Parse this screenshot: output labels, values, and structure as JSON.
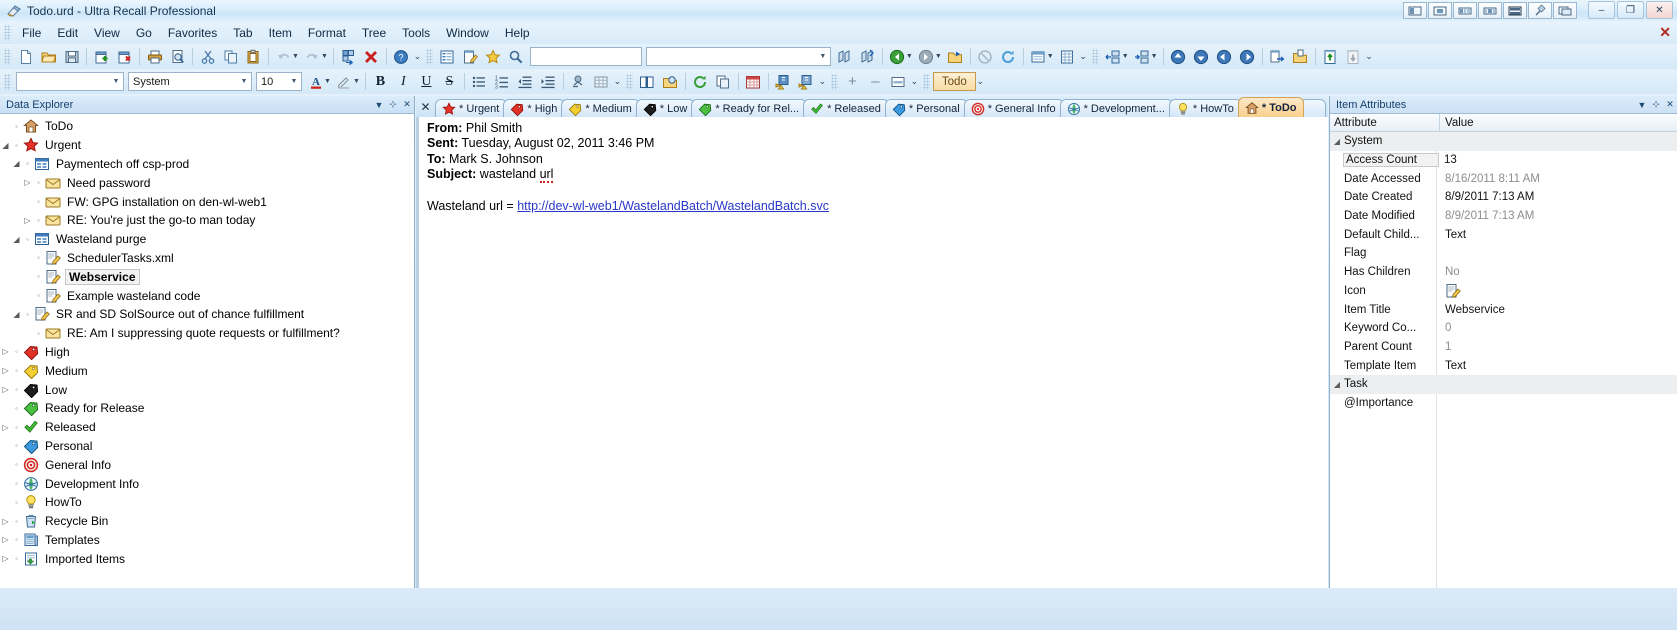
{
  "window": {
    "title": "Todo.urd - Ultra Recall Professional",
    "app_icon": "urd-app-icon",
    "layout_buttons": [
      "layout-1-icon",
      "layout-2-icon",
      "layout-3-icon",
      "layout-4-icon",
      "layout-5-icon",
      "pin-icon",
      "layout-6-icon"
    ],
    "minimize": "–",
    "maximize": "❐",
    "close": "✕"
  },
  "menu": {
    "items": [
      {
        "label": "File"
      },
      {
        "label": "Edit"
      },
      {
        "label": "View"
      },
      {
        "label": "Go"
      },
      {
        "label": "Favorites"
      },
      {
        "label": "Tab"
      },
      {
        "label": "Item"
      },
      {
        "label": "Format"
      },
      {
        "label": "Tree"
      },
      {
        "label": "Tools"
      },
      {
        "label": "Window"
      },
      {
        "label": "Help"
      }
    ],
    "close_doc_label": "✕"
  },
  "toolbar_main": {
    "buttons": [
      {
        "name": "new-document-icon"
      },
      {
        "name": "open-folder-icon"
      },
      {
        "name": "save-icon"
      },
      {
        "name": "new-item-icon"
      },
      {
        "name": "delete-item-icon"
      },
      {
        "name": "print-icon"
      },
      {
        "name": "print-preview-icon"
      },
      {
        "name": "cut-icon"
      },
      {
        "name": "copy-icon"
      },
      {
        "name": "paste-icon"
      },
      {
        "name": "undo-icon"
      },
      {
        "name": "redo-icon"
      },
      {
        "name": "insert-child-icon"
      },
      {
        "name": "delete-red-x-icon"
      },
      {
        "name": "help-icon"
      }
    ],
    "group2": [
      {
        "name": "outline-icon"
      },
      {
        "name": "edit-note-icon"
      },
      {
        "name": "favorites-star-icon"
      },
      {
        "name": "search-magnifier-icon"
      }
    ],
    "search_value": "",
    "search_placeholder": "",
    "group3": [
      {
        "name": "find-icon"
      },
      {
        "name": "find-next-icon"
      },
      {
        "name": "back-green-icon"
      },
      {
        "name": "forward-gray-icon"
      },
      {
        "name": "open-item-icon"
      },
      {
        "name": "cancel-icon"
      },
      {
        "name": "refresh-icon"
      },
      {
        "name": "pane-layout-icon"
      },
      {
        "name": "grid-icon"
      }
    ],
    "group4": [
      {
        "name": "indent-item-icon"
      },
      {
        "name": "outdent-item-icon"
      },
      {
        "name": "move-up-icon"
      },
      {
        "name": "move-down-icon"
      },
      {
        "name": "move-left-icon"
      },
      {
        "name": "move-right-icon"
      },
      {
        "name": "export-icon"
      },
      {
        "name": "import-icon"
      },
      {
        "name": "promote-icon"
      },
      {
        "name": "demote-icon"
      }
    ]
  },
  "toolbar_format": {
    "style_value": "",
    "font_value": "System",
    "size_value": "10",
    "buttons": [
      {
        "name": "font-color-icon"
      },
      {
        "name": "highlight-icon"
      },
      {
        "name": "bold-icon",
        "label": "B"
      },
      {
        "name": "italic-icon",
        "label": "I"
      },
      {
        "name": "underline-icon",
        "label": "U"
      },
      {
        "name": "strikethrough-icon",
        "label": "S"
      },
      {
        "name": "bullet-list-icon"
      },
      {
        "name": "numbered-list-icon"
      },
      {
        "name": "decrease-indent-icon"
      },
      {
        "name": "increase-indent-icon"
      },
      {
        "name": "insert-link-icon"
      },
      {
        "name": "insert-table-icon"
      }
    ],
    "group2": [
      {
        "name": "dictionary-icon"
      },
      {
        "name": "folder-search-icon"
      },
      {
        "name": "sync-icon"
      },
      {
        "name": "duplicate-icon"
      },
      {
        "name": "calendar-icon"
      },
      {
        "name": "reminder-add-icon"
      },
      {
        "name": "reminder-edit-icon"
      }
    ],
    "group3": [
      {
        "name": "expand-all-icon",
        "label": "+"
      },
      {
        "name": "collapse-all-icon",
        "label": "–"
      },
      {
        "name": "collapse-level-icon"
      }
    ],
    "tab_badge": "Todo"
  },
  "left_panel": {
    "title": "Data Explorer",
    "menu_icon": "chevron-down-icon",
    "pin_icon": "pin-icon",
    "close_icon": "close-icon",
    "tree": [
      {
        "label": "ToDo",
        "indent": 0,
        "icon": "home-icon",
        "expander": "",
        "selected": false
      },
      {
        "label": "Urgent",
        "indent": 0,
        "icon": "star-red-icon",
        "expander": "expanded",
        "selected": false
      },
      {
        "label": "Paymentech off csp-prod",
        "indent": 1,
        "icon": "calendar-blue-icon",
        "expander": "expanded",
        "selected": false
      },
      {
        "label": "Need password",
        "indent": 2,
        "icon": "envelope-icon",
        "expander": "collapsed",
        "selected": false
      },
      {
        "label": "FW: GPG installation on den-wl-web1",
        "indent": 2,
        "icon": "envelope-icon",
        "expander": "",
        "selected": false
      },
      {
        "label": "RE: You're just the go-to man today",
        "indent": 2,
        "icon": "envelope-icon",
        "expander": "collapsed",
        "selected": false
      },
      {
        "label": "Wasteland purge",
        "indent": 1,
        "icon": "calendar-blue-icon",
        "expander": "expanded",
        "selected": false
      },
      {
        "label": "SchedulerTasks.xml",
        "indent": 2,
        "icon": "note-edit-icon",
        "expander": "",
        "selected": false
      },
      {
        "label": "Webservice",
        "indent": 2,
        "icon": "note-edit-icon",
        "expander": "",
        "selected": true
      },
      {
        "label": "Example wasteland code",
        "indent": 2,
        "icon": "note-edit-icon",
        "expander": "",
        "selected": false
      },
      {
        "label": "SR and SD SolSource out of chance fulfillment",
        "indent": 1,
        "icon": "note-edit-icon",
        "expander": "expanded",
        "selected": false
      },
      {
        "label": "RE: Am I suppressing quote requests or fulfillment?",
        "indent": 2,
        "icon": "envelope-icon",
        "expander": "",
        "selected": false
      },
      {
        "label": "High",
        "indent": 0,
        "icon": "tag-red-icon",
        "expander": "collapsed",
        "selected": false
      },
      {
        "label": "Medium",
        "indent": 0,
        "icon": "tag-yellow-icon",
        "expander": "collapsed",
        "selected": false
      },
      {
        "label": "Low",
        "indent": 0,
        "icon": "tag-black-icon",
        "expander": "collapsed",
        "selected": false
      },
      {
        "label": "Ready for Release",
        "indent": 0,
        "icon": "tag-green-icon",
        "expander": "",
        "selected": false
      },
      {
        "label": "Released",
        "indent": 0,
        "icon": "check-green-icon",
        "expander": "collapsed",
        "selected": false
      },
      {
        "label": "Personal",
        "indent": 0,
        "icon": "tag-blue-icon",
        "expander": "",
        "selected": false
      },
      {
        "label": "General Info",
        "indent": 0,
        "icon": "target-red-icon",
        "expander": "",
        "selected": false
      },
      {
        "label": "Development Info",
        "indent": 0,
        "icon": "globe-icon",
        "expander": "",
        "selected": false
      },
      {
        "label": "HowTo",
        "indent": 0,
        "icon": "lightbulb-icon",
        "expander": "",
        "selected": false
      },
      {
        "label": "Recycle Bin",
        "indent": 0,
        "icon": "recycle-bin-icon",
        "expander": "collapsed",
        "selected": false
      },
      {
        "label": "Templates",
        "indent": 0,
        "icon": "templates-icon",
        "expander": "collapsed",
        "selected": false
      },
      {
        "label": "Imported Items",
        "indent": 0,
        "icon": "imported-items-icon",
        "expander": "collapsed",
        "selected": false
      }
    ]
  },
  "center": {
    "close_tab_label": "✕",
    "tabs": [
      {
        "label": "* Urgent",
        "icon": "star-red-icon",
        "active": false
      },
      {
        "label": "* High",
        "icon": "tag-red-icon",
        "active": false
      },
      {
        "label": "* Medium",
        "icon": "tag-yellow-icon",
        "active": false
      },
      {
        "label": "* Low",
        "icon": "tag-black-icon",
        "active": false
      },
      {
        "label": "* Ready for Rel...",
        "icon": "tag-green-icon",
        "active": false
      },
      {
        "label": "* Released",
        "icon": "check-green-icon",
        "active": false
      },
      {
        "label": "* Personal",
        "icon": "tag-blue-icon",
        "active": false
      },
      {
        "label": "* General Info",
        "icon": "target-red-icon",
        "active": false
      },
      {
        "label": "* Development...",
        "icon": "globe-icon",
        "active": false
      },
      {
        "label": "* HowTo",
        "icon": "lightbulb-icon",
        "active": false
      },
      {
        "label": "* ToDo",
        "icon": "home-icon",
        "active": true
      }
    ],
    "document": {
      "from_label": "From:",
      "from_value": "Phil Smith",
      "sent_label": "Sent:",
      "sent_value": "Tuesday, August 02, 2011 3:46 PM",
      "to_label": "To:",
      "to_value": "Mark S. Johnson",
      "subject_label": "Subject:",
      "subject_value": "wasteland url",
      "body_prefix": "Wasteland url = ",
      "body_link": "http://dev-wl-web1/WastelandBatch/WastelandBatch.svc"
    }
  },
  "right_panel": {
    "title": "Item Attributes",
    "menu_icon": "chevron-down-icon",
    "pin_icon": "pin-icon",
    "close_icon": "close-icon",
    "columns": {
      "attribute": "Attribute",
      "value": "Value"
    },
    "rows": [
      {
        "name": "System",
        "value": "",
        "group": true,
        "expander": "expanded",
        "dim": false,
        "selected": false
      },
      {
        "name": "Access Count",
        "value": "13",
        "group": false,
        "dim": false,
        "selected": true
      },
      {
        "name": "Date Accessed",
        "value": "8/16/2011 8:11 AM",
        "group": false,
        "dim": true,
        "selected": false
      },
      {
        "name": "Date Created",
        "value": "8/9/2011 7:13 AM",
        "group": false,
        "dim": false,
        "selected": false
      },
      {
        "name": "Date Modified",
        "value": "8/9/2011 7:13 AM",
        "group": false,
        "dim": true,
        "selected": false
      },
      {
        "name": "Default Child...",
        "value": "Text",
        "group": false,
        "dim": false,
        "selected": false
      },
      {
        "name": "Flag",
        "value": "",
        "group": false,
        "dim": false,
        "selected": false
      },
      {
        "name": "Has Children",
        "value": "No",
        "group": false,
        "dim": true,
        "selected": false
      },
      {
        "name": "Icon",
        "value": "",
        "group": false,
        "dim": false,
        "selected": false,
        "icon": "note-edit-icon"
      },
      {
        "name": "Item Title",
        "value": "Webservice",
        "group": false,
        "dim": false,
        "selected": false
      },
      {
        "name": "Keyword Co...",
        "value": "0",
        "group": false,
        "dim": true,
        "selected": false
      },
      {
        "name": "Parent Count",
        "value": "1",
        "group": false,
        "dim": true,
        "selected": false
      },
      {
        "name": "Template Item",
        "value": "Text",
        "group": false,
        "dim": false,
        "selected": false
      },
      {
        "name": "Task",
        "value": "",
        "group": true,
        "expander": "expanded",
        "dim": false,
        "selected": false
      },
      {
        "name": "@Importance",
        "value": "",
        "group": false,
        "dim": false,
        "selected": false
      }
    ]
  },
  "colors": {
    "accent": "#f9cf8e",
    "link": "#2a38c8",
    "panel_title": "#15406b",
    "chrome": "#d6e9f8"
  }
}
